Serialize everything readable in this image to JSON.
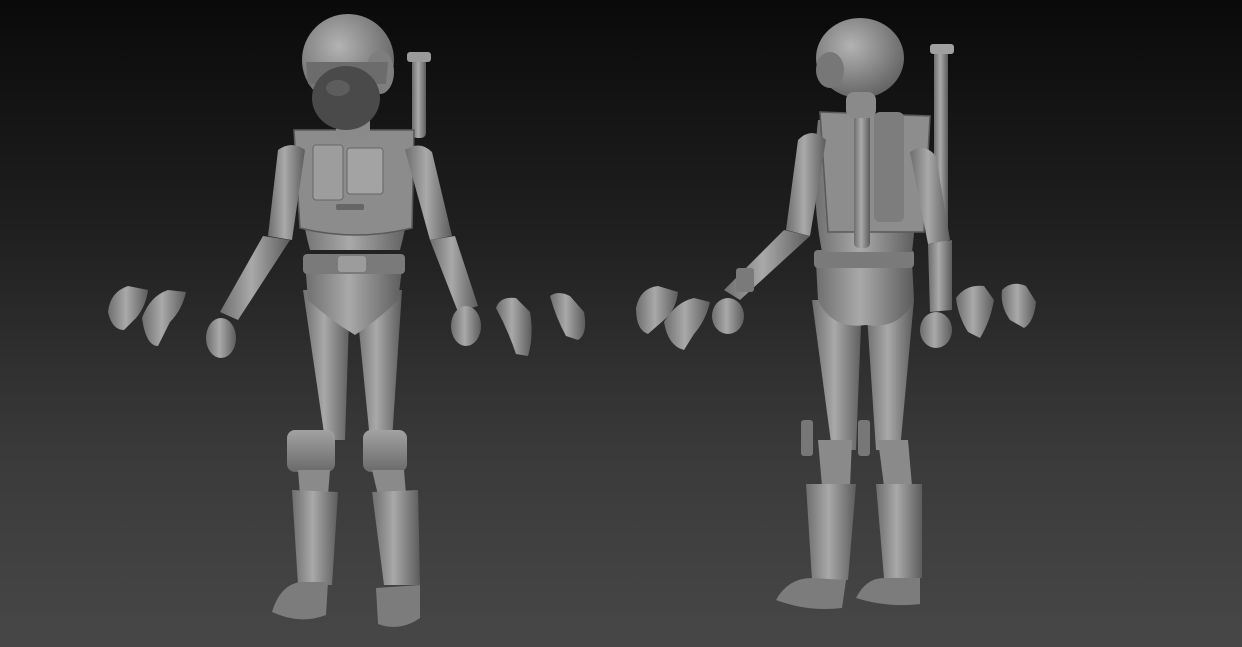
{
  "scene": {
    "background_top": "#0a0a0a",
    "background_bottom": "#474747",
    "model_color": "#8e8e8e",
    "model_shade": "#5f5f5f",
    "model_highlight": "#c4c4c4",
    "figures": [
      {
        "view": "front",
        "pose": "A-pose",
        "accessories": [
          "helmet",
          "visor",
          "chest-armor",
          "belt",
          "knee-pads",
          "boots",
          "backpack-tube"
        ]
      },
      {
        "view": "back",
        "pose": "A-pose",
        "accessories": [
          "helmet",
          "backpack",
          "twin-tubes",
          "belt",
          "boots"
        ]
      }
    ],
    "loose_hands_count": 8
  }
}
